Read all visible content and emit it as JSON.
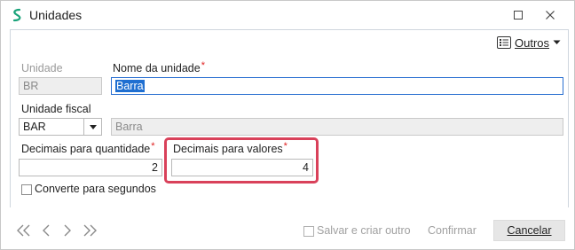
{
  "window": {
    "title": "Unidades"
  },
  "toolbar": {
    "outros_label": "Outros"
  },
  "form": {
    "unidade": {
      "label": "Unidade",
      "value": "BR"
    },
    "nome_unidade": {
      "label": "Nome da unidade",
      "required_mark": "*",
      "value": "Barra"
    },
    "unidade_fiscal": {
      "label": "Unidade fiscal",
      "value": "BAR",
      "description": "Barra"
    },
    "decimais_quantidade": {
      "label": "Decimais para quantidade",
      "required_mark": "*",
      "value": "2"
    },
    "decimais_valores": {
      "label": "Decimais para valores",
      "required_mark": "*",
      "value": "4"
    },
    "converte_segundos": {
      "label": "Converte para segundos",
      "checked": false
    }
  },
  "footer": {
    "salvar_criar_outro_label": "Salvar e criar outro",
    "salvar_criar_outro_checked": false,
    "confirmar_label": "Confirmar",
    "cancelar_label": "Cancelar"
  },
  "colors": {
    "highlight": "#d9415a",
    "selection": "#1f6fd1",
    "focus_border": "#2a6fd1",
    "app_icon": "#1aa37a"
  }
}
